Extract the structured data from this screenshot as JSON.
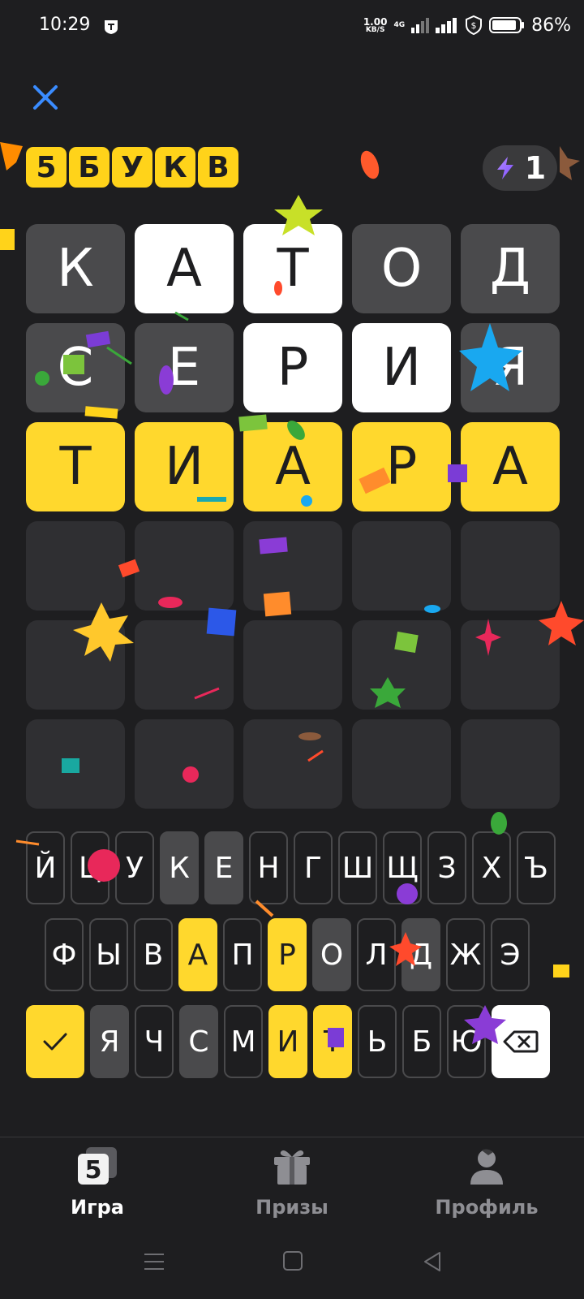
{
  "status_bar": {
    "time": "10:29",
    "net_speed_value": "1.00",
    "net_speed_unit": "KB/S",
    "network_type": "4G",
    "battery_percent": "86%"
  },
  "header": {
    "title_letters": [
      "5",
      "Б",
      "У",
      "К",
      "В"
    ],
    "energy_count": "1"
  },
  "colors": {
    "background": "#1e1e20",
    "correct": "#ffd82d",
    "present": "#ffffff",
    "absent": "#4a4a4c",
    "empty": "#2f2f32"
  },
  "board": {
    "rows": [
      {
        "letters": [
          "К",
          "А",
          "Т",
          "О",
          "Д"
        ],
        "states": [
          "absent",
          "present",
          "present",
          "absent",
          "absent"
        ]
      },
      {
        "letters": [
          "С",
          "Е",
          "Р",
          "И",
          "Я"
        ],
        "states": [
          "absent",
          "absent",
          "present",
          "present",
          "absent"
        ]
      },
      {
        "letters": [
          "Т",
          "И",
          "А",
          "Р",
          "А"
        ],
        "states": [
          "correct",
          "correct",
          "correct",
          "correct",
          "correct"
        ]
      },
      {
        "letters": [
          "",
          "",
          "",
          "",
          ""
        ],
        "states": [
          "empty",
          "empty",
          "empty",
          "empty",
          "empty"
        ]
      },
      {
        "letters": [
          "",
          "",
          "",
          "",
          ""
        ],
        "states": [
          "empty",
          "empty",
          "empty",
          "empty",
          "empty"
        ]
      },
      {
        "letters": [
          "",
          "",
          "",
          "",
          ""
        ],
        "states": [
          "empty",
          "empty",
          "empty",
          "empty",
          "empty"
        ]
      }
    ]
  },
  "keyboard": {
    "row1": [
      {
        "label": "Й",
        "state": "unused"
      },
      {
        "label": "Ц",
        "state": "unused"
      },
      {
        "label": "У",
        "state": "unused"
      },
      {
        "label": "К",
        "state": "absent"
      },
      {
        "label": "Е",
        "state": "absent"
      },
      {
        "label": "Н",
        "state": "unused"
      },
      {
        "label": "Г",
        "state": "unused"
      },
      {
        "label": "Ш",
        "state": "unused"
      },
      {
        "label": "Щ",
        "state": "unused"
      },
      {
        "label": "З",
        "state": "unused"
      },
      {
        "label": "Х",
        "state": "unused"
      },
      {
        "label": "Ъ",
        "state": "unused"
      }
    ],
    "row2": [
      {
        "label": "Ф",
        "state": "unused"
      },
      {
        "label": "Ы",
        "state": "unused"
      },
      {
        "label": "В",
        "state": "unused"
      },
      {
        "label": "А",
        "state": "correct"
      },
      {
        "label": "П",
        "state": "unused"
      },
      {
        "label": "Р",
        "state": "correct"
      },
      {
        "label": "О",
        "state": "absent"
      },
      {
        "label": "Л",
        "state": "unused"
      },
      {
        "label": "Д",
        "state": "absent"
      },
      {
        "label": "Ж",
        "state": "unused"
      },
      {
        "label": "Э",
        "state": "unused"
      }
    ],
    "row3": [
      {
        "label": "Я",
        "state": "absent"
      },
      {
        "label": "Ч",
        "state": "unused"
      },
      {
        "label": "С",
        "state": "absent"
      },
      {
        "label": "М",
        "state": "unused"
      },
      {
        "label": "И",
        "state": "correct"
      },
      {
        "label": "Т",
        "state": "correct"
      },
      {
        "label": "Ь",
        "state": "unused"
      },
      {
        "label": "Б",
        "state": "unused"
      },
      {
        "label": "Ю",
        "state": "unused"
      }
    ]
  },
  "bottom_nav": {
    "items": [
      {
        "label": "Игра",
        "icon": "game-icon",
        "active": true
      },
      {
        "label": "Призы",
        "icon": "gift-icon",
        "active": false
      },
      {
        "label": "Профиль",
        "icon": "profile-icon",
        "active": false
      }
    ]
  },
  "icons": {
    "close": "close-icon",
    "energy": "lightning-icon",
    "enter": "checkmark-icon",
    "backspace": "backspace-icon"
  }
}
